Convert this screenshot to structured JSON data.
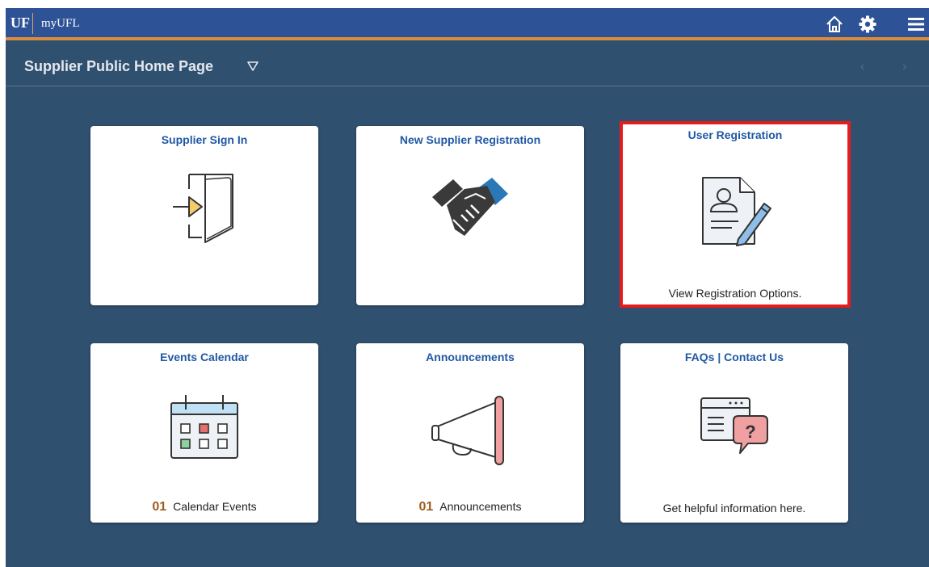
{
  "header": {
    "logo": "UF",
    "app_name": "myUFL",
    "icons": [
      "home-icon",
      "gear-icon",
      "menu-icon"
    ]
  },
  "page": {
    "title": "Supplier Public Home Page",
    "title_dropdown_icon": "triangle-down-outline-icon",
    "prev_arrow": "‹",
    "next_arrow": "›"
  },
  "tiles": [
    {
      "title": "Supplier Sign In",
      "icon": "door-enter-icon",
      "footer": ""
    },
    {
      "title": "New Supplier Registration",
      "icon": "handshake-icon",
      "footer": ""
    },
    {
      "title": "User Registration",
      "icon": "profile-document-pencil-icon",
      "footer": "View Registration Options.",
      "highlighted": true
    },
    {
      "title": "Events Calendar",
      "icon": "calendar-icon",
      "count": "01",
      "footer": "Calendar Events"
    },
    {
      "title": "Announcements",
      "icon": "megaphone-icon",
      "count": "01",
      "footer": "Announcements"
    },
    {
      "title": "FAQs | Contact Us",
      "icon": "faq-chat-icon",
      "footer": "Get helpful information here."
    }
  ],
  "colors": {
    "topbar": "#2d5396",
    "topbar_accent": "#d88b3c",
    "background": "#30506f",
    "tile_title": "#1f58a4",
    "count": "#a25a1e",
    "highlight_border": "#e51c1c"
  }
}
